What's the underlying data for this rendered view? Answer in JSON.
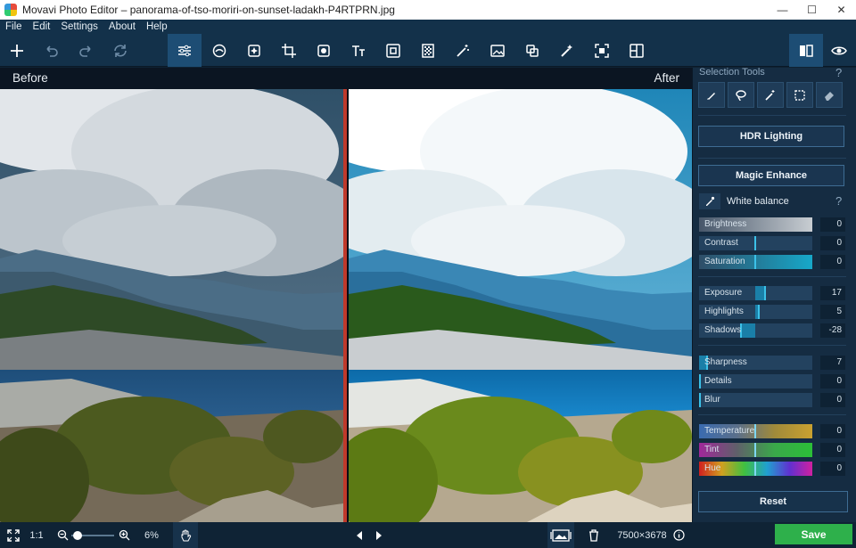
{
  "window": {
    "title": "Movavi Photo Editor – panorama-of-tso-moriri-on-sunset-ladakh-P4RTPRN.jpg",
    "minimize": "—",
    "maximize": "☐",
    "close": "✕"
  },
  "menu": [
    "File",
    "Edit",
    "Settings",
    "About",
    "Help"
  ],
  "toolbar": {
    "tools": [
      "add-icon",
      "undo-icon",
      "redo-icon",
      "reset-rotate-icon",
      "adjust-icon",
      "retouch-icon",
      "effects-icon",
      "crop-icon",
      "object-removal-icon",
      "text-icon",
      "frames-icon",
      "background-icon",
      "magic-wand-icon",
      "image-icon",
      "layers-icon",
      "denoise-icon",
      "select-object-icon",
      "split-icon"
    ],
    "active_tool": "adjust-icon",
    "right": [
      "before-after-icon",
      "eye-icon"
    ]
  },
  "preview": {
    "before_label": "Before",
    "after_label": "After"
  },
  "panel": {
    "selection_title": "Selection Tools",
    "help": "?",
    "selection_tools": [
      "brush-icon",
      "lasso-icon",
      "magic-wand-icon",
      "rect-select-icon",
      "eraser-icon"
    ],
    "hdr_label": "HDR Lighting",
    "magic_label": "Magic Enhance",
    "wb_label": "White balance",
    "sliders": [
      {
        "label": "Brightness",
        "value": "0"
      },
      {
        "label": "Contrast",
        "value": "0"
      },
      {
        "label": "Saturation",
        "value": "0"
      },
      {
        "label": "Exposure",
        "value": "17"
      },
      {
        "label": "Highlights",
        "value": "5"
      },
      {
        "label": "Shadows",
        "value": "-28"
      },
      {
        "label": "Sharpness",
        "value": "7"
      },
      {
        "label": "Details",
        "value": "0"
      },
      {
        "label": "Blur",
        "value": "0"
      },
      {
        "label": "Temperature",
        "value": "0"
      },
      {
        "label": "Tint",
        "value": "0"
      },
      {
        "label": "Hue",
        "value": "0"
      }
    ],
    "reset_label": "Reset"
  },
  "status": {
    "fit_icon": "fit-screen-icon",
    "ratio": "1:1",
    "zoom_percent": 6,
    "zoom_label": "6%",
    "image_size": "7500×3678",
    "save_label": "Save"
  },
  "colors": {
    "accent": "#1d4d74",
    "slider_knob": "#3cc1e8",
    "save": "#2eb04b",
    "divider": "#c0392b"
  }
}
